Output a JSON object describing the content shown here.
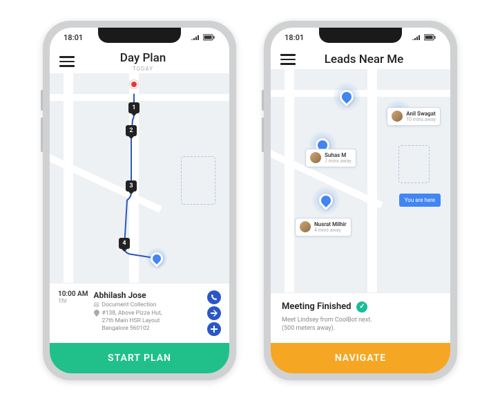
{
  "status_bar": {
    "time": "18:01"
  },
  "phone1": {
    "title": "Day Plan",
    "subtitle": "TODAY",
    "stops": [
      "1",
      "2",
      "3",
      "4"
    ],
    "detail": {
      "time": "10:00 AM",
      "duration": "1hr",
      "name": "Abhilash Jose",
      "type": "Document Collection",
      "address_line1": "#138, Above Pizza Hut,",
      "address_line2": "27th Main HSR Layout",
      "address_line3": "Bangalore 560102"
    },
    "cta": "START PLAN"
  },
  "phone2": {
    "title": "Leads Near Me",
    "leads": [
      {
        "name": "Anil Swagat",
        "sub": "10 mins away"
      },
      {
        "name": "Suhas M",
        "sub": "7 mins away"
      },
      {
        "name": "Nusrat Milhir",
        "sub": "4 mins away"
      }
    ],
    "here_label": "You  are here",
    "status": {
      "title": "Meeting Finished",
      "desc_line1": "Meet Lindsey from CoolBot next.",
      "desc_line2": "(500 meters away)."
    },
    "cta": "NAVIGATE"
  },
  "colors": {
    "primary_blue": "#4285f4",
    "cta_green": "#21c08b",
    "cta_orange": "#f5a623",
    "marker_red": "#e53935"
  }
}
